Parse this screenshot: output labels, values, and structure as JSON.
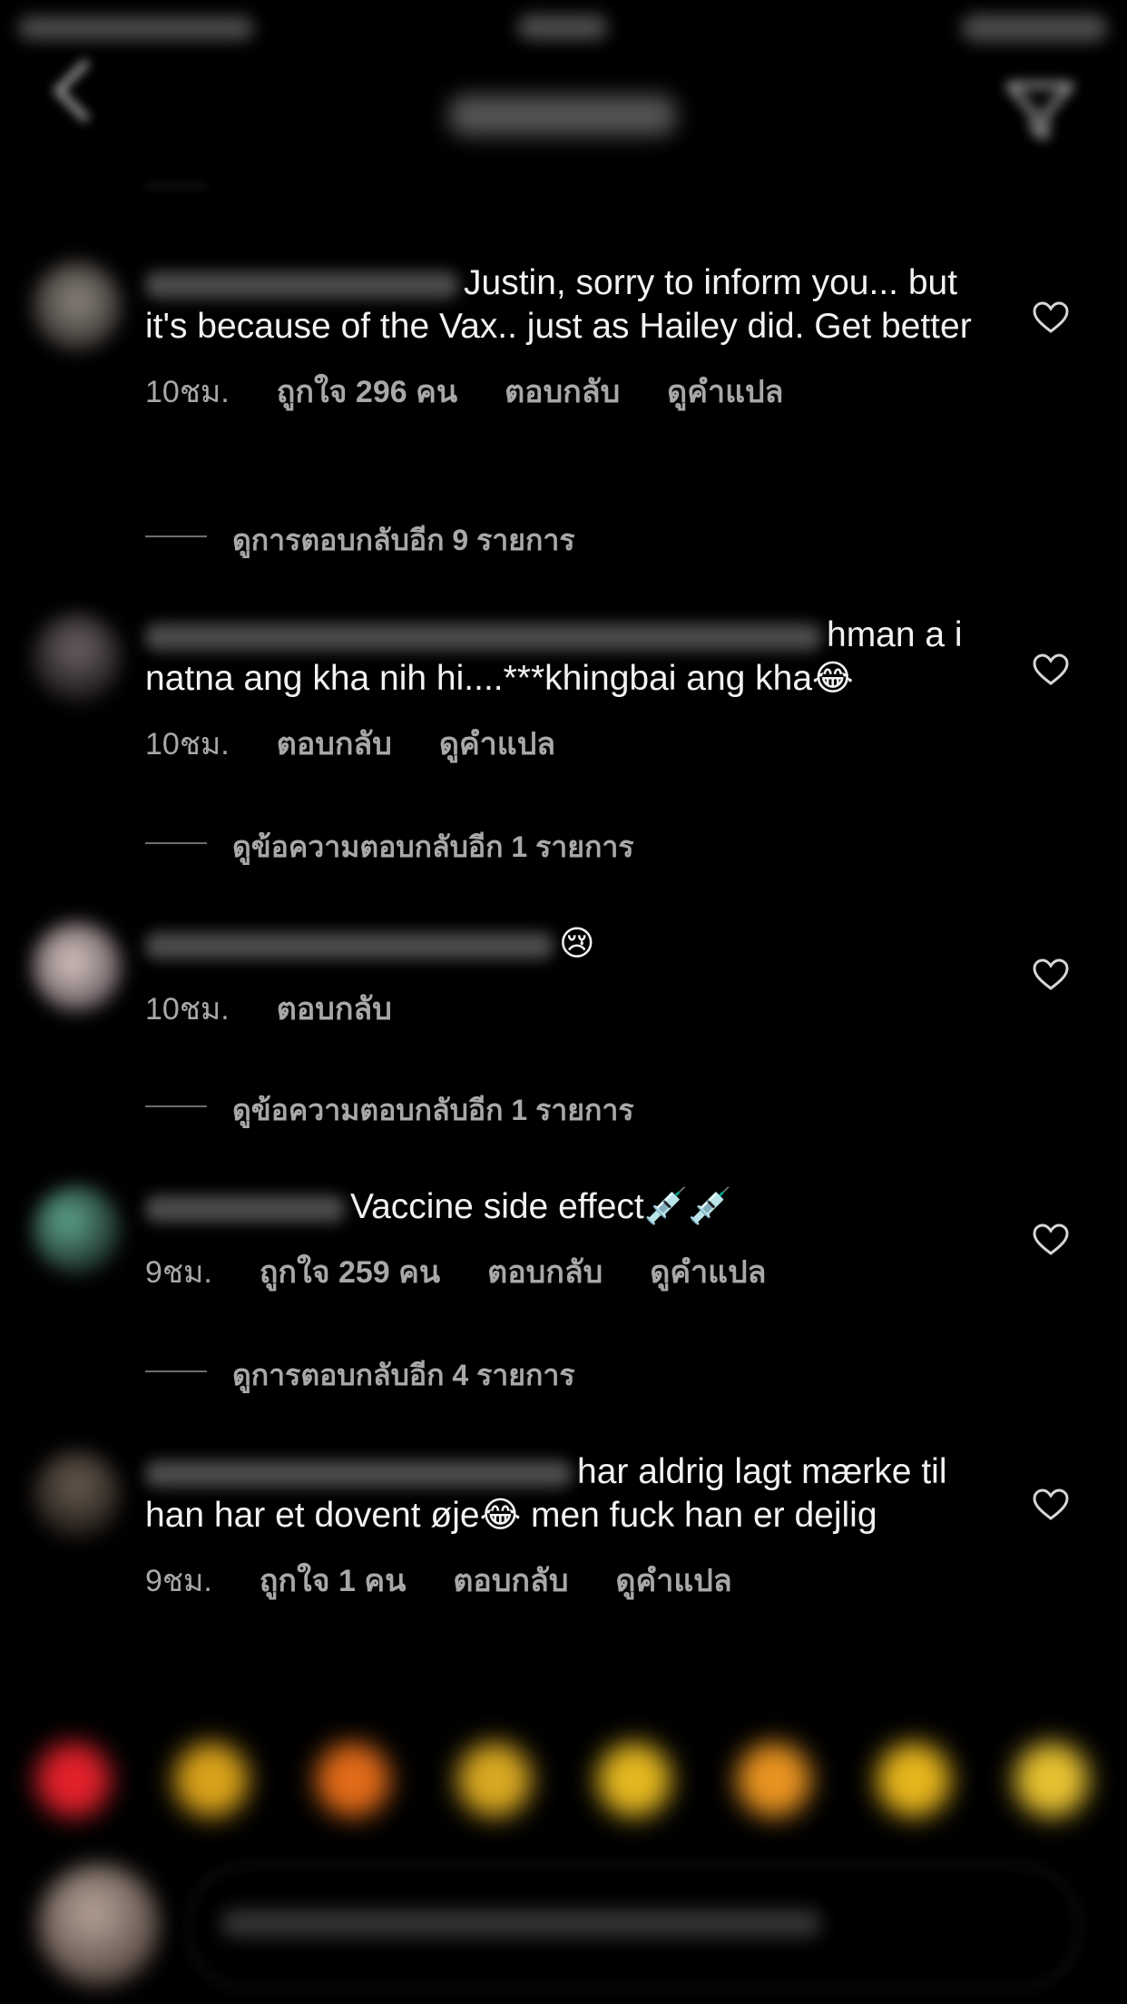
{
  "comments": [
    {
      "text": "Justin, sorry to inform you... but it's because of the Vax.. just as Hailey did. Get better",
      "time": "10ชม.",
      "likes": "ถูกใจ 296 คน",
      "reply": "ตอบกลับ",
      "translate": "ดูคำแปล",
      "more_replies": "ดูการตอบกลับอีก 9 รายการ"
    },
    {
      "text": "hman a i natna ang kha nih hi....***khingbai ang kha😂",
      "time": "10ชม.",
      "reply": "ตอบกลับ",
      "translate": "ดูคำแปล",
      "more_replies": "ดูข้อความตอบกลับอีก 1 รายการ"
    },
    {
      "text": "😢",
      "time": "10ชม.",
      "reply": "ตอบกลับ",
      "more_replies": "ดูข้อความตอบกลับอีก 1 รายการ"
    },
    {
      "text": "Vaccine side effect💉💉",
      "time": "9ชม.",
      "likes": "ถูกใจ 259 คน",
      "reply": "ตอบกลับ",
      "translate": "ดูคำแปล",
      "more_replies": "ดูการตอบกลับอีก 4 รายการ"
    },
    {
      "text": "har aldrig lagt mærke til han har et dovent øje😂 men fuck han er dejlig",
      "time": "9ชม.",
      "likes": "ถูกใจ 1 คน",
      "reply": "ตอบกลับ",
      "translate": "ดูคำแปล"
    }
  ],
  "icons": {
    "back": "back-chevron-icon",
    "filter": "filter-icon",
    "like": "heart-icon"
  },
  "colors": {
    "background": "#000000",
    "text": "#f2f2f2",
    "secondary_text": "#a8a8a8"
  }
}
